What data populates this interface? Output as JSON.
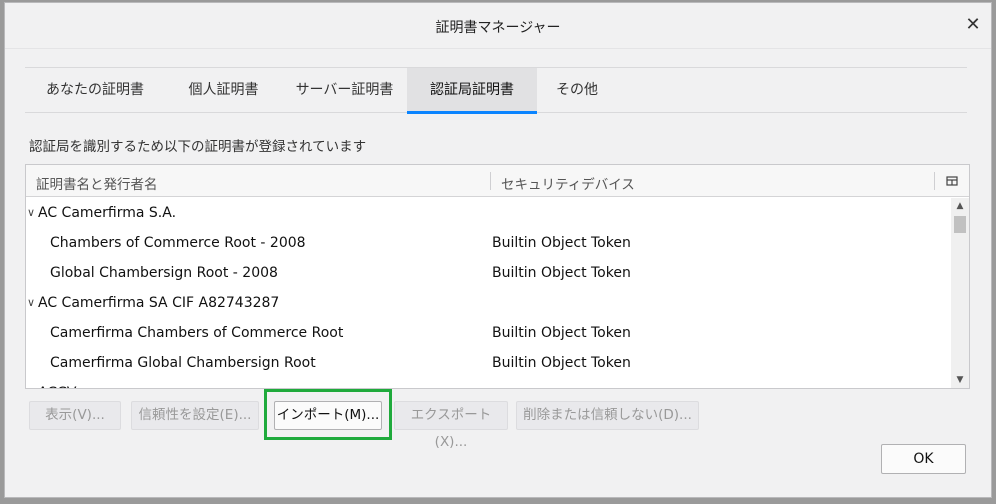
{
  "window": {
    "title": "証明書マネージャー"
  },
  "tabs": [
    {
      "label": "あなたの証明書"
    },
    {
      "label": "個人証明書"
    },
    {
      "label": "サーバー証明書"
    },
    {
      "label": "認証局証明書",
      "selected": true
    },
    {
      "label": "その他"
    }
  ],
  "description": "認証局を識別するため以下の証明書が登録されています",
  "tree": {
    "columns": {
      "name": "証明書名と発行者名",
      "device": "セキュリティデバイス"
    },
    "rows": [
      {
        "type": "group",
        "name": "AC Camerfirma S.A.",
        "device": ""
      },
      {
        "type": "cert",
        "name": "Chambers of Commerce Root - 2008",
        "device": "Builtin Object Token"
      },
      {
        "type": "cert",
        "name": "Global Chambersign Root - 2008",
        "device": "Builtin Object Token"
      },
      {
        "type": "group",
        "name": "AC Camerfirma SA CIF A82743287",
        "device": ""
      },
      {
        "type": "cert",
        "name": "Camerfirma Chambers of Commerce Root",
        "device": "Builtin Object Token"
      },
      {
        "type": "cert",
        "name": "Camerfirma Global Chambersign Root",
        "device": "Builtin Object Token"
      },
      {
        "type": "group",
        "name": "ACCV",
        "device": ""
      }
    ]
  },
  "buttons": {
    "view": "表示(V)...",
    "trust": "信頼性を設定(E)...",
    "import": "インポート(M)...",
    "export": "エクスポート(X)...",
    "delete": "削除または信頼しない(D)...",
    "ok": "OK"
  },
  "colors": {
    "accent": "#0a84ff",
    "highlight": "#1faa3c"
  }
}
